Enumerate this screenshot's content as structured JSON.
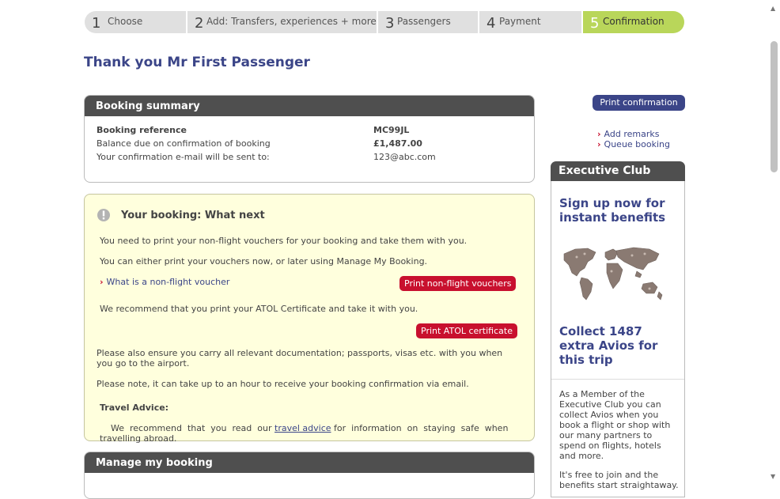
{
  "steps": [
    {
      "num": "1",
      "label": "Choose"
    },
    {
      "num": "2",
      "label": "Add: Transfers, experiences + more"
    },
    {
      "num": "3",
      "label": "Passengers"
    },
    {
      "num": "4",
      "label": "Payment"
    },
    {
      "num": "5",
      "label": "Confirmation"
    }
  ],
  "page_title": "Thank you Mr First Passenger",
  "booking_summary": {
    "header": "Booking summary",
    "rows": [
      {
        "label": "Booking reference",
        "value": "MC99JL"
      },
      {
        "label": "Balance due on confirmation of booking",
        "value": "£1,487.00"
      },
      {
        "label": "Your confirmation e-mail will be sent to:",
        "value": "123@abc.com"
      }
    ]
  },
  "what_next": {
    "header": "Your booking: What next",
    "p1": "You need to print your non-flight vouchers for your booking and take them with you.",
    "p2": "You can either print your vouchers now, or later using Manage My Booking.",
    "voucher_link": "What is a non-flight voucher",
    "print_vouchers_btn": "Print non-flight vouchers",
    "p3": "We recommend that you print your ATOL Certificate and take it with you.",
    "print_atol_btn": "Print ATOL certificate",
    "p4_line1": "Please also ensure you carry all relevant documentation; passports, visas etc. with you when",
    "p4_line2": "you go to the airport.",
    "p5": "Please note, it can take up to an hour to receive your booking confirmation via email.",
    "travel_title": "Travel Advice:",
    "travel_pre": "We  recommend  that  you  read  our",
    "travel_link": "travel advice",
    "travel_post": "for  information  on  staying  safe  when",
    "travel_line2": "travelling abroad."
  },
  "manage_booking": {
    "header": "Manage my booking"
  },
  "sidebar": {
    "print_confirmation": "Print confirmation",
    "links": [
      "Add remarks",
      "Queue booking"
    ]
  },
  "exec_club": {
    "header": "Executive Club",
    "signup": [
      "Sign up now for",
      "instant benefits"
    ],
    "collect": [
      "Collect 1487",
      "extra Avios for",
      "this trip"
    ],
    "member_text": [
      "As a Member of the",
      "Executive Club you can",
      "collect Avios when you",
      "book a flight or shop with",
      "our many partners to",
      "spend on flights, hotels",
      "and more."
    ],
    "free_text": [
      "It's free to join and the",
      "benefits start straightaway."
    ]
  },
  "colors": {
    "brand_blue": "#3b4588",
    "active_step": "#b9d65a",
    "red_button": "#c8102e",
    "panel_header": "#4f4f4f",
    "notice_bg": "#ffffdd"
  }
}
